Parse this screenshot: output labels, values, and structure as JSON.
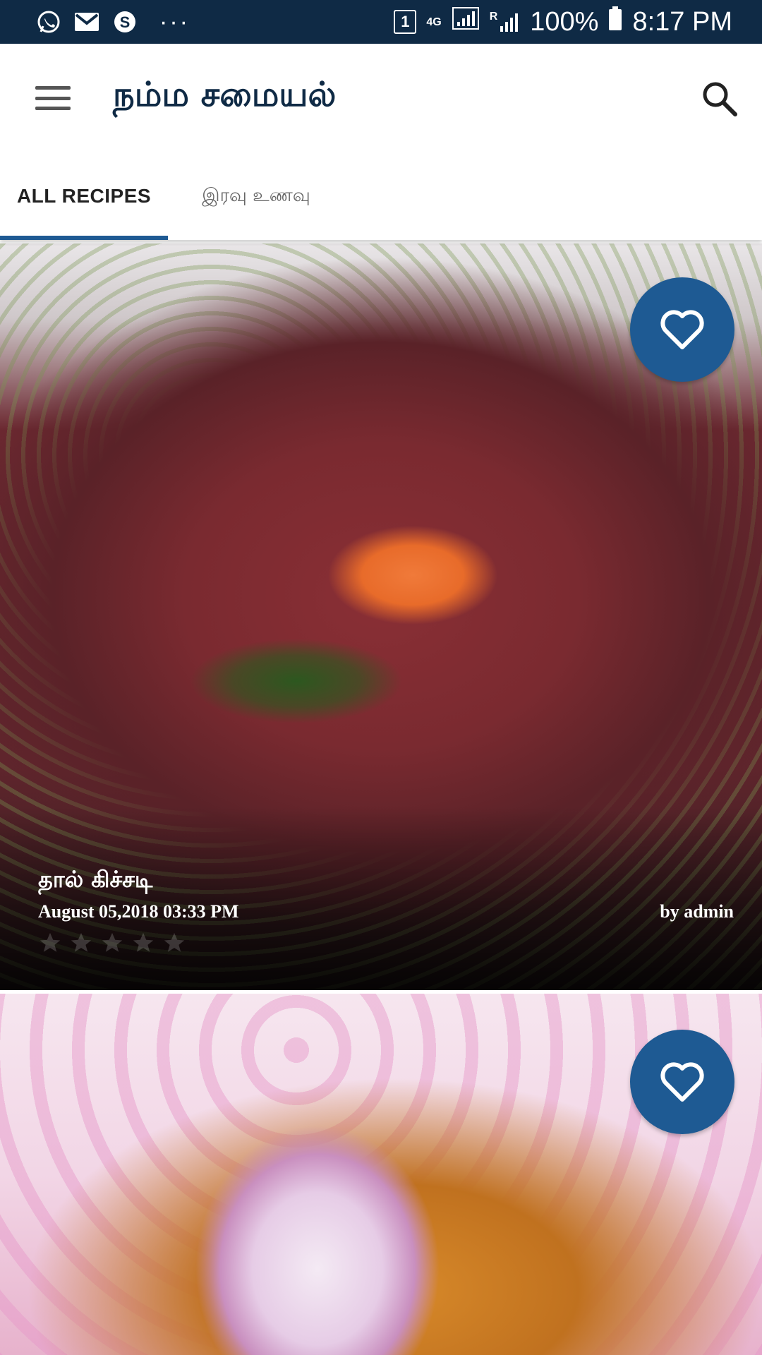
{
  "status_bar": {
    "icons_left": [
      "whatsapp-icon",
      "gmail-icon",
      "skype-icon"
    ],
    "overflow": "···",
    "sim_slot": "1",
    "network": "4G",
    "signal_r": "R",
    "battery": "100%",
    "time": "8:17 PM"
  },
  "app_bar": {
    "title": "நம்ம சமையல்",
    "menu_icon": "hamburger-menu-icon",
    "search_icon": "search-icon"
  },
  "tabs": [
    {
      "label": "ALL RECIPES",
      "selected": true
    },
    {
      "label": "இரவு உணவு",
      "selected": false
    }
  ],
  "recipes": [
    {
      "title": "தால் கிச்சடி",
      "date": "August 05,2018 03:33 PM",
      "author": "by admin",
      "rating_stars": 5
    },
    {
      "title": "",
      "date": "",
      "author": ""
    }
  ],
  "colors": {
    "primary": "#1e5a93",
    "status_bar": "#0f2a45",
    "title_text": "#0f2a45"
  }
}
